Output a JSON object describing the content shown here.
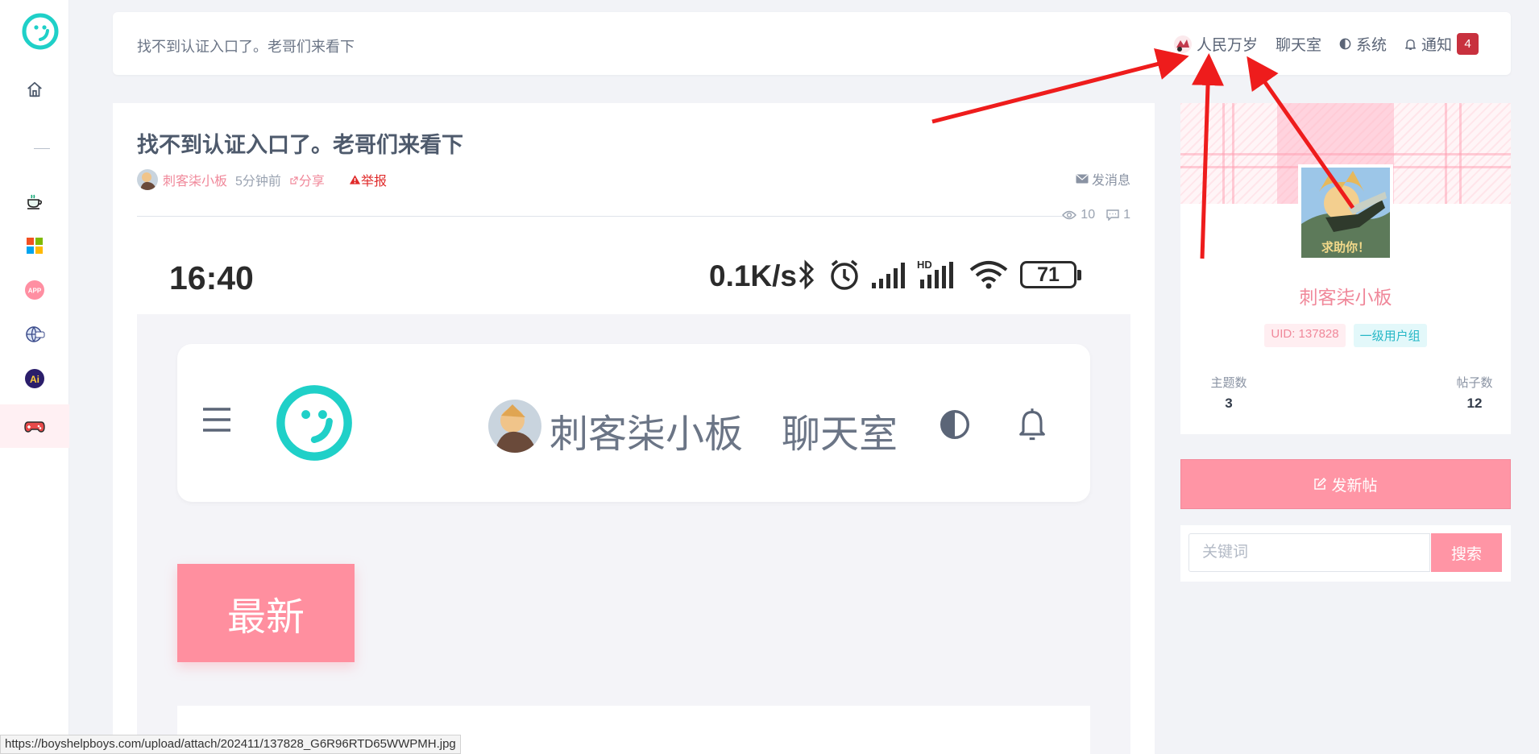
{
  "sidebar": {
    "items": [
      {
        "name": "home",
        "icon": "home-icon"
      },
      {
        "name": "divider",
        "icon": "dash"
      },
      {
        "name": "tea",
        "icon": "tea-cup-icon"
      },
      {
        "name": "windows",
        "icon": "windows-icon"
      },
      {
        "name": "app",
        "icon": "app-icon",
        "label": "APP"
      },
      {
        "name": "globe",
        "icon": "globe-icon"
      },
      {
        "name": "ai",
        "icon": "ai-icon",
        "label": "Ai"
      },
      {
        "name": "game",
        "icon": "gamepad-icon",
        "active": true
      }
    ]
  },
  "header": {
    "title": "找不到认证入口了。老哥们来看下",
    "user_label": "人民万岁",
    "chat_label": "聊天室",
    "theme_label": "系统",
    "notify_label": "通知",
    "notify_count": "4"
  },
  "post": {
    "title": "找不到认证入口了。老哥们来看下",
    "author": "刺客柒小板",
    "time": "5分钟前",
    "share_label": "分享",
    "report_label": "举报",
    "message_label": "发消息",
    "views": "10",
    "comments": "1"
  },
  "screenshot": {
    "time": "16:40",
    "speed": "0.1K/s",
    "battery": "71",
    "user_name": "刺客柒小板",
    "chat_label": "聊天室",
    "tab_label": "最新"
  },
  "profile": {
    "name": "刺客柒小板",
    "uid": "UID: 137828",
    "group": "一级用户组",
    "topics_label": "主题数",
    "topics_value": "3",
    "posts_label": "帖子数",
    "posts_value": "12"
  },
  "actions": {
    "new_post": "发新帖",
    "search_placeholder": "关键词",
    "search_button": "搜索"
  },
  "status_url": "https://boyshelpboys.com/upload/attach/202411/137828_G6R96RTD65WWPMH.jpg",
  "colors": {
    "accent_pink": "#ff95a5",
    "logo_teal": "#1fd0c8",
    "badge_red": "#c8313e",
    "arrow_red": "#ee1c1c"
  }
}
